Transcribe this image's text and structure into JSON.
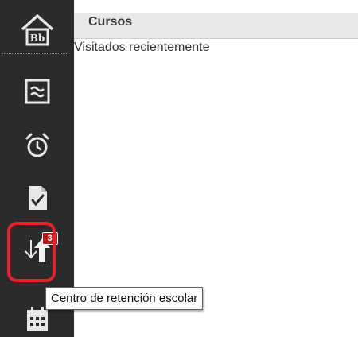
{
  "header": {
    "title": "Cursos"
  },
  "main": {
    "recent_label": "Visitados recientemente"
  },
  "sidebar": {
    "items": [
      {
        "name": "home",
        "icon": "blackboard-home-icon",
        "label": "Bb"
      },
      {
        "name": "stream",
        "icon": "activity-stream-icon"
      },
      {
        "name": "due-dates",
        "icon": "alarm-clock-icon"
      },
      {
        "name": "grades",
        "icon": "graded-document-icon"
      },
      {
        "name": "retention-center",
        "icon": "retention-arrows-icon",
        "badge": "3",
        "tooltip": "Centro de retención escolar",
        "highlighted": true
      },
      {
        "name": "calendar",
        "icon": "calendar-icon"
      }
    ]
  },
  "colors": {
    "rail": "#2b2b2b",
    "header": "#e9e9e9",
    "badge": "#b5191b",
    "highlight": "#e8202a"
  }
}
